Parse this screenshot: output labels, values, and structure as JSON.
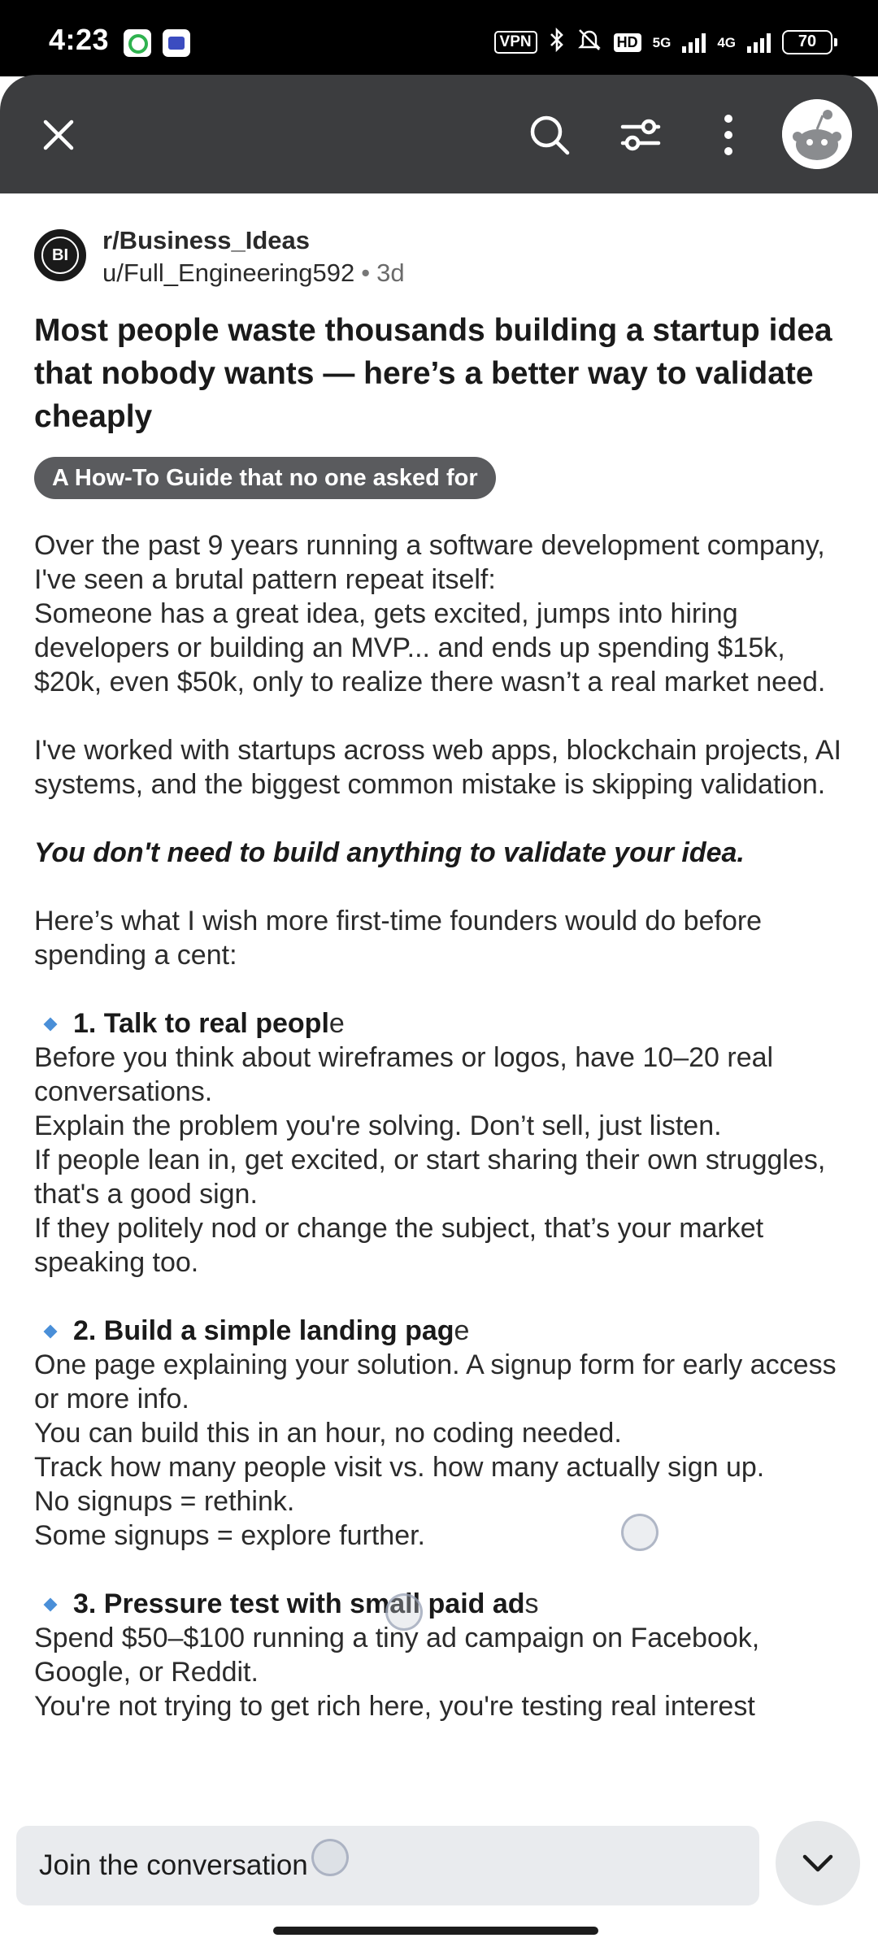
{
  "status_bar": {
    "time": "4:23",
    "vpn": "VPN",
    "hd": "HD",
    "net_5g": "5G",
    "net_4g": "4G",
    "battery": "70"
  },
  "app_bar": {
    "icons": [
      "close-icon",
      "search-icon",
      "filter-icon",
      "more-vert-icon",
      "user-avatar"
    ]
  },
  "post": {
    "subreddit": "r/Business_Ideas",
    "subreddit_avatar": "BI",
    "author": "u/Full_Engineering592",
    "age": "3d",
    "title": "Most people waste thousands building a startup idea that nobody wants — here’s a better way to validate cheaply",
    "flair": "A How-To Guide that no one asked for",
    "intro": [
      "Over the past 9 years running a software development company, I've seen a brutal pattern repeat itself:",
      "Someone has a great idea, gets excited, jumps into hiring developers or building an MVP... and ends up spending $15k, $20k, even $50k, only to realize there wasn’t a real market need."
    ],
    "para2": "I've worked with startups across web apps, blockchain projects, AI systems, and the biggest common mistake is skipping validation.",
    "emphasis": "You don't need to build anything to validate your idea.",
    "para4": "Here’s what I wish more first-time founders would do before spending a cent:",
    "sections": [
      {
        "heading_bold": "1. Talk to real peopl",
        "heading_rest": "e",
        "lines": [
          "Before you think about wireframes or logos, have 10–20 real conversations.",
          "Explain the problem you're solving. Don’t sell, just listen.",
          "If people lean in, get excited, or start sharing their own struggles, that's a good sign.",
          "If they politely nod or change the subject, that’s your market speaking too."
        ]
      },
      {
        "heading_bold": "2. Build a simple landing pag",
        "heading_rest": "e",
        "lines": [
          "One page explaining your solution. A signup form for early access or more info.",
          "You can build this in an hour, no coding needed.",
          "Track how many people visit vs. how many actually sign up.",
          "No signups = rethink.",
          "Some signups = explore further."
        ]
      },
      {
        "heading_bold": "3. Pressure test with small paid ad",
        "heading_rest": "s",
        "lines": [
          "Spend $50–$100 running a tiny ad campaign on Facebook, Google, or Reddit.",
          "You're not trying to get rich here, you're testing real interest"
        ]
      }
    ]
  },
  "bottom_bar": {
    "comment_placeholder": "Join the conversation"
  },
  "colors": {
    "app_bar": "#3c3d3f",
    "flair": "#5a5b5e",
    "bullet": "#4a8fd8"
  }
}
